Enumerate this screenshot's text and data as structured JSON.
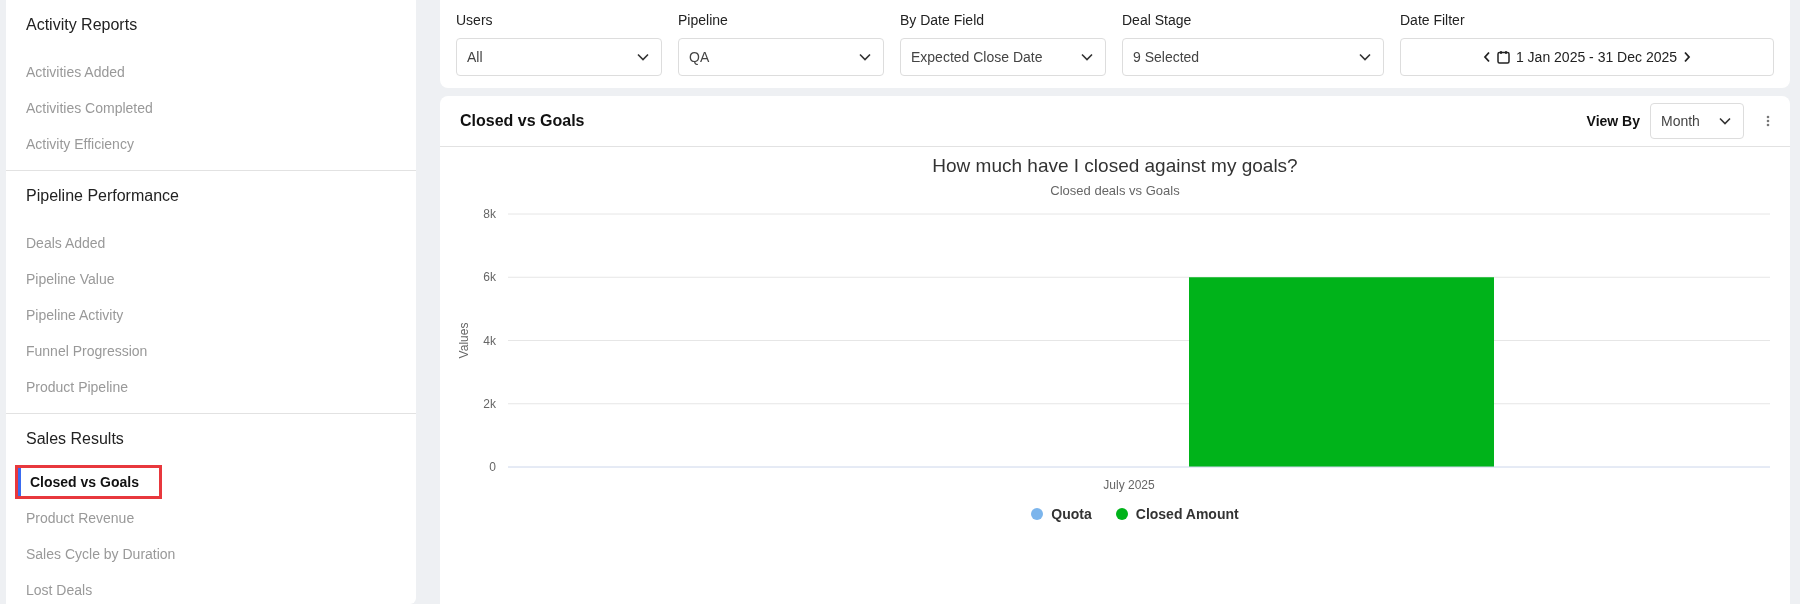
{
  "sidebar": {
    "sections": [
      {
        "title": "Activity Reports",
        "items": [
          {
            "label": "Activities Added",
            "selected": false
          },
          {
            "label": "Activities Completed",
            "selected": false
          },
          {
            "label": "Activity Efficiency",
            "selected": false
          }
        ]
      },
      {
        "title": "Pipeline Performance",
        "items": [
          {
            "label": "Deals Added",
            "selected": false
          },
          {
            "label": "Pipeline Value",
            "selected": false
          },
          {
            "label": "Pipeline Activity",
            "selected": false
          },
          {
            "label": "Funnel Progression",
            "selected": false
          },
          {
            "label": "Product Pipeline",
            "selected": false
          }
        ]
      },
      {
        "title": "Sales Results",
        "items": [
          {
            "label": "Closed vs Goals",
            "selected": true
          },
          {
            "label": "Product Revenue",
            "selected": false
          },
          {
            "label": "Sales Cycle by Duration",
            "selected": false
          },
          {
            "label": "Lost Deals",
            "selected": false
          }
        ]
      }
    ]
  },
  "filters": [
    {
      "label": "Users",
      "value": "All"
    },
    {
      "label": "Pipeline",
      "value": "QA"
    },
    {
      "label": "By Date Field",
      "value": "Expected Close Date"
    },
    {
      "label": "Deal Stage",
      "value": "9 Selected"
    }
  ],
  "date_filter": {
    "label": "Date Filter",
    "value": "1 Jan 2025 - 31 Dec 2025"
  },
  "report": {
    "title": "Closed vs Goals",
    "view_by_label": "View By",
    "view_by": "Month",
    "subtitle": "Closed deals vs Goals",
    "chart_data": {
      "type": "bar",
      "title": "How much have I closed against my goals?",
      "ylabel": "Values",
      "categories": [
        "July 2025"
      ],
      "series": [
        {
          "name": "Quota",
          "color": "#7cb5ec",
          "values": [
            0
          ]
        },
        {
          "name": "Closed Amount",
          "color": "#00b31a",
          "values": [
            6000
          ]
        }
      ],
      "ylim": [
        0,
        8000
      ],
      "grid": true,
      "yticks": [
        {
          "value": 0,
          "label": "0"
        },
        {
          "value": 2000,
          "label": "2k"
        },
        {
          "value": 4000,
          "label": "4k"
        },
        {
          "value": 6000,
          "label": "6k"
        },
        {
          "value": 8000,
          "label": "8k"
        }
      ]
    }
  }
}
